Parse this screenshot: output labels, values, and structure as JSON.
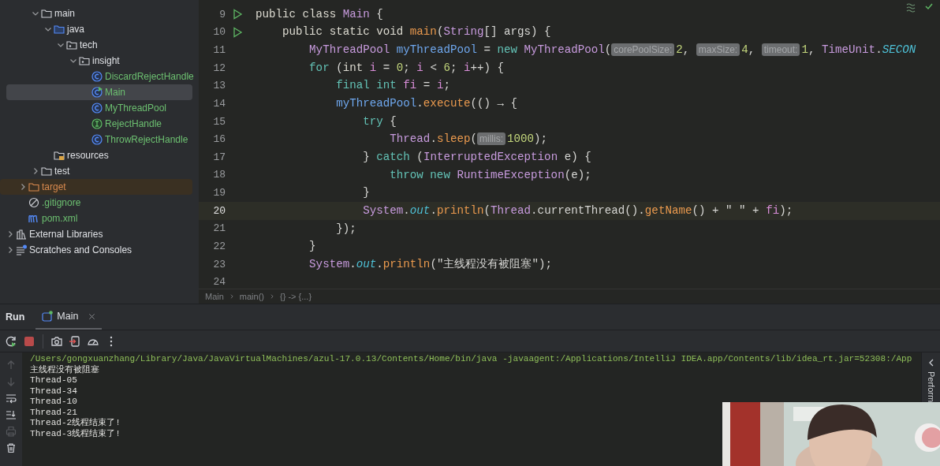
{
  "project_tree": [
    {
      "children": [
        {
          "children": [
            {
              "label": "main",
              "kind": "folder",
              "expanded": true,
              "selected": false,
              "children": [
                {
                  "label": "java",
                  "kind": "sourcefolder",
                  "expanded": true,
                  "selected": false,
                  "children": [
                    {
                      "label": "tech",
                      "kind": "package",
                      "expanded": true,
                      "selected": false,
                      "children": [
                        {
                          "label": "insight",
                          "kind": "package",
                          "expanded": true,
                          "selected": false,
                          "children": [
                            {
                              "label": "DiscardRejectHandle",
                              "kind": "class",
                              "selected": false,
                              "color": "#6cbf70"
                            },
                            {
                              "label": "Main",
                              "kind": "mainclass",
                              "selected": true,
                              "color": "#6cbf70"
                            },
                            {
                              "label": "MyThreadPool",
                              "kind": "class",
                              "selected": false,
                              "color": "#6cbf70"
                            },
                            {
                              "label": "RejectHandle",
                              "kind": "interface",
                              "selected": false,
                              "color": "#6cbf70"
                            },
                            {
                              "label": "ThrowRejectHandle",
                              "kind": "class",
                              "selected": false,
                              "color": "#6cbf70"
                            }
                          ]
                        }
                      ]
                    }
                  ]
                },
                {
                  "label": "resources",
                  "kind": "resources",
                  "selected": false,
                  "color": "#dfe1e5"
                }
              ]
            },
            {
              "label": "test",
              "kind": "folder",
              "expanded": false,
              "selected": false
            }
          ]
        },
        {
          "label": "target",
          "kind": "excluded",
          "expanded": false,
          "selected": false,
          "color": "#d98a4e"
        },
        {
          "label": ".gitignore",
          "kind": "ignore",
          "selected": false,
          "color": "#6cbf70"
        },
        {
          "label": "pom.xml",
          "kind": "maven",
          "selected": false,
          "color": "#6cbf70"
        }
      ]
    },
    {
      "label": "External Libraries",
      "kind": "libraries",
      "expanded": false,
      "selected": false
    },
    {
      "label": "Scratches and Consoles",
      "kind": "scratches",
      "expanded": false,
      "selected": false
    }
  ],
  "editor": {
    "lines": [
      {
        "number": "9",
        "run": true,
        "current": false,
        "tokens": [
          {
            "t": "public class",
            "kind": "kw"
          },
          {
            "t": "Main",
            "kind": "cls"
          },
          {
            "t": "{",
            "kind": "p"
          }
        ]
      },
      {
        "number": "10",
        "run": true,
        "current": false,
        "tokens": [
          {
            "t": "    public static void",
            "kind": "kw"
          },
          {
            "t": "main",
            "kind": "fn"
          },
          {
            "t": "(",
            "kind": "p",
            "tight": true
          },
          {
            "t": "String",
            "kind": "cls",
            "tight": true
          },
          {
            "t": "[] args) {",
            "kind": "p",
            "tight": true
          }
        ]
      },
      {
        "number": "11",
        "run": false,
        "current": false,
        "tokens": [
          {
            "t": "        MyThreadPool",
            "kind": "cls"
          },
          {
            "t": "myThreadPool",
            "kind": "var"
          },
          {
            "t": "=",
            "kind": "p"
          },
          {
            "t": "new",
            "kind": "kw2"
          },
          {
            "t": "MyThreadPool",
            "kind": "cls"
          },
          {
            "t": "(",
            "kind": "p",
            "tight": true
          },
          {
            "t": "corePoolSize:",
            "kind": "hint",
            "tight": true
          },
          {
            "t": "2",
            "kind": "num",
            "tight": true
          },
          {
            "t": ",",
            "kind": "p",
            "tight": true
          },
          {
            "t": "maxSize:",
            "kind": "hint"
          },
          {
            "t": "4",
            "kind": "num",
            "tight": true
          },
          {
            "t": ",",
            "kind": "p",
            "tight": true
          },
          {
            "t": "timeout:",
            "kind": "hint"
          },
          {
            "t": "1",
            "kind": "num",
            "tight": true
          },
          {
            "t": ",",
            "kind": "p",
            "tight": true
          },
          {
            "t": "TimeUnit",
            "kind": "cls"
          },
          {
            "t": ".",
            "kind": "p",
            "tight": true
          },
          {
            "t": "SECON",
            "kind": "field",
            "tight": true
          }
        ]
      },
      {
        "number": "12",
        "run": false,
        "current": false,
        "tokens": [
          {
            "t": "        for",
            "kind": "kw2"
          },
          {
            "t": "(",
            "kind": "p"
          },
          {
            "t": "int",
            "kind": "kw",
            "tight": true
          },
          {
            "t": "i",
            "kind": "loc"
          },
          {
            "t": "=",
            "kind": "p"
          },
          {
            "t": "0",
            "kind": "num"
          },
          {
            "t": ";",
            "kind": "p",
            "tight": true
          },
          {
            "t": "i",
            "kind": "loc"
          },
          {
            "t": "<",
            "kind": "p"
          },
          {
            "t": "6",
            "kind": "num"
          },
          {
            "t": ";",
            "kind": "p",
            "tight": true
          },
          {
            "t": "i",
            "kind": "loc"
          },
          {
            "t": "++) {",
            "kind": "p",
            "tight": true
          }
        ]
      },
      {
        "number": "13",
        "run": false,
        "current": false,
        "tokens": [
          {
            "t": "            final int",
            "kind": "kw2"
          },
          {
            "t": "fi",
            "kind": "loc"
          },
          {
            "t": "=",
            "kind": "p"
          },
          {
            "t": "i",
            "kind": "loc"
          },
          {
            "t": ";",
            "kind": "p",
            "tight": true
          }
        ]
      },
      {
        "number": "14",
        "run": false,
        "current": false,
        "tokens": [
          {
            "t": "            myThreadPool",
            "kind": "var"
          },
          {
            "t": ".",
            "kind": "p",
            "tight": true
          },
          {
            "t": "execute",
            "kind": "fn",
            "tight": true
          },
          {
            "t": "(() → {",
            "kind": "p",
            "tight": true
          }
        ]
      },
      {
        "number": "15",
        "run": false,
        "current": false,
        "tokens": [
          {
            "t": "                try",
            "kind": "kw2"
          },
          {
            "t": "{",
            "kind": "p"
          }
        ]
      },
      {
        "number": "16",
        "run": false,
        "current": false,
        "tokens": [
          {
            "t": "                    Thread",
            "kind": "cls"
          },
          {
            "t": ".",
            "kind": "p",
            "tight": true
          },
          {
            "t": "sleep",
            "kind": "fn",
            "tight": true
          },
          {
            "t": "(",
            "kind": "p",
            "tight": true
          },
          {
            "t": "millis:",
            "kind": "hint",
            "tight": true
          },
          {
            "t": "1000",
            "kind": "num",
            "tight": true
          },
          {
            "t": ");",
            "kind": "p",
            "tight": true
          }
        ]
      },
      {
        "number": "17",
        "run": false,
        "current": false,
        "tokens": [
          {
            "t": "                }",
            "kind": "p"
          },
          {
            "t": "catch",
            "kind": "kw2"
          },
          {
            "t": "(",
            "kind": "p"
          },
          {
            "t": "InterruptedException",
            "kind": "cls",
            "tight": true
          },
          {
            "t": "e) {",
            "kind": "p"
          }
        ]
      },
      {
        "number": "18",
        "run": false,
        "current": false,
        "tokens": [
          {
            "t": "                    throw new",
            "kind": "kw2"
          },
          {
            "t": "RuntimeException",
            "kind": "cls"
          },
          {
            "t": "(e);",
            "kind": "p",
            "tight": true
          }
        ]
      },
      {
        "number": "19",
        "run": false,
        "current": false,
        "tokens": [
          {
            "t": "                }",
            "kind": "p"
          }
        ]
      },
      {
        "number": "20",
        "run": false,
        "current": true,
        "tokens": [
          {
            "t": "                System",
            "kind": "cls"
          },
          {
            "t": ".",
            "kind": "p",
            "tight": true
          },
          {
            "t": "out",
            "kind": "field",
            "tight": true
          },
          {
            "t": ".",
            "kind": "p",
            "tight": true
          },
          {
            "t": "println",
            "kind": "fn",
            "tight": true
          },
          {
            "t": "(",
            "kind": "p",
            "tight": true
          },
          {
            "t": "Thread",
            "kind": "cls",
            "tight": true
          },
          {
            "t": ".currentThread().",
            "kind": "p",
            "tight": true
          },
          {
            "t": "getName",
            "kind": "fn",
            "tight": true
          },
          {
            "t": "() + \" \" +",
            "kind": "p",
            "tight": true
          },
          {
            "t": "fi",
            "kind": "loc"
          },
          {
            "t": ");",
            "kind": "p",
            "tight": true
          }
        ]
      },
      {
        "number": "21",
        "run": false,
        "current": false,
        "tokens": [
          {
            "t": "            });",
            "kind": "p"
          }
        ]
      },
      {
        "number": "22",
        "run": false,
        "current": false,
        "tokens": [
          {
            "t": "        }",
            "kind": "p"
          }
        ]
      },
      {
        "number": "23",
        "run": false,
        "current": false,
        "tokens": [
          {
            "t": "        System",
            "kind": "cls"
          },
          {
            "t": ".",
            "kind": "p",
            "tight": true
          },
          {
            "t": "out",
            "kind": "field",
            "tight": true
          },
          {
            "t": ".",
            "kind": "p",
            "tight": true
          },
          {
            "t": "println",
            "kind": "fn",
            "tight": true
          },
          {
            "t": "(\"主线程没有被阻塞\");",
            "kind": "p",
            "tight": true
          }
        ]
      },
      {
        "number": "24",
        "run": false,
        "current": false
      }
    ],
    "breadcrumbs": [
      "Main",
      "main()",
      "{} -> {...}"
    ]
  },
  "run_panel": {
    "title": "Run",
    "tabs": [
      {
        "label": "Main",
        "selected": true
      }
    ],
    "console": [
      {
        "kind": "command",
        "text": "/Users/gongxuanzhang/Library/Java/JavaVirtualMachines/azul-17.0.13/Contents/Home/bin/java -javaagent:/Applications/IntelliJ IDEA.app/Contents/lib/idea_rt.jar=52308:/App"
      },
      {
        "kind": "output",
        "text": "主线程没有被阻塞"
      },
      {
        "kind": "output",
        "text": "Thread-05"
      },
      {
        "kind": "output",
        "text": "Thread-34"
      },
      {
        "kind": "output",
        "text": "Thread-10"
      },
      {
        "kind": "output",
        "text": "Thread-21"
      },
      {
        "kind": "output",
        "text": "Thread-2线程结束了!"
      },
      {
        "kind": "output",
        "text": "Thread-3线程结束了!"
      }
    ],
    "side_tab": "Perform"
  }
}
